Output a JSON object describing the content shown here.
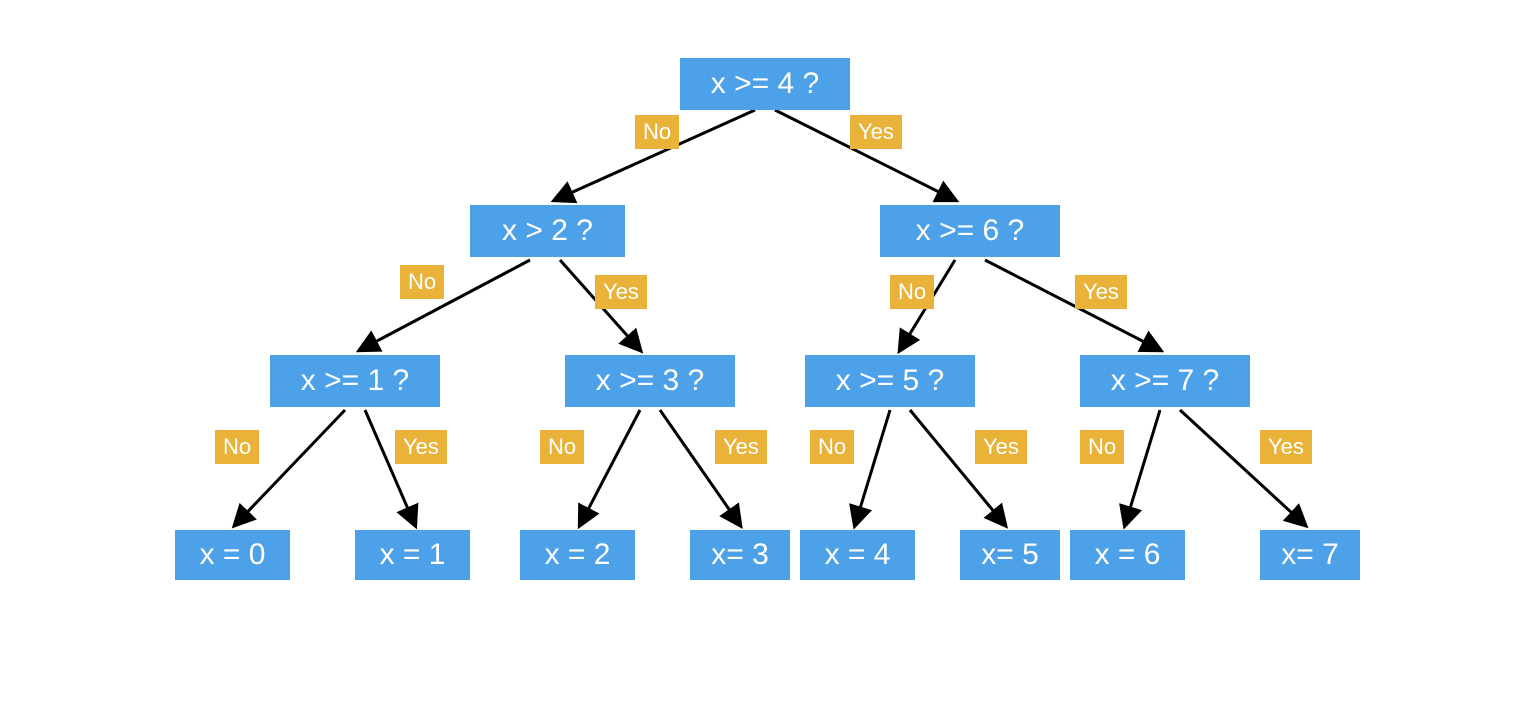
{
  "colors": {
    "node": "#4da1e8",
    "badge": "#e9b33a",
    "arrow": "#000000"
  },
  "labels": {
    "yes": "Yes",
    "no": "No"
  },
  "nodes": {
    "root": "x >= 4 ?",
    "n2": "x > 2 ?",
    "n6": "x >= 6 ?",
    "n1": "x >= 1 ?",
    "n3": "x >= 3 ?",
    "n5": "x >= 5 ?",
    "n7": "x >= 7 ?",
    "leaf0": "x = 0",
    "leaf1": "x = 1",
    "leaf2": "x = 2",
    "leaf3": "x= 3",
    "leaf4": "x = 4",
    "leaf5": "x= 5",
    "leaf6": "x = 6",
    "leaf7": "x= 7"
  },
  "diagram_data": {
    "type": "decision-tree",
    "description": "Binary search decision tree over integer x in [0,7]. Each internal node asks a threshold question; No branches go left and Yes branches go right. Leaves give the resolved value of x.",
    "root": "root",
    "tree": {
      "root": {
        "question": "x >= 4 ?",
        "no": "n2",
        "yes": "n6"
      },
      "n2": {
        "question": "x > 2 ?",
        "no": "n1",
        "yes": "n3"
      },
      "n6": {
        "question": "x >= 6 ?",
        "no": "n5",
        "yes": "n7"
      },
      "n1": {
        "question": "x >= 1 ?",
        "no": "leaf0",
        "yes": "leaf1"
      },
      "n3": {
        "question": "x >= 3 ?",
        "no": "leaf2",
        "yes": "leaf3"
      },
      "n5": {
        "question": "x >= 5 ?",
        "no": "leaf4",
        "yes": "leaf5"
      },
      "n7": {
        "question": "x >= 7 ?",
        "no": "leaf6",
        "yes": "leaf7"
      },
      "leaf0": {
        "result": "x = 0"
      },
      "leaf1": {
        "result": "x = 1"
      },
      "leaf2": {
        "result": "x = 2"
      },
      "leaf3": {
        "result": "x= 3"
      },
      "leaf4": {
        "result": "x = 4"
      },
      "leaf5": {
        "result": "x= 5"
      },
      "leaf6": {
        "result": "x = 6"
      },
      "leaf7": {
        "result": "x= 7"
      }
    }
  }
}
